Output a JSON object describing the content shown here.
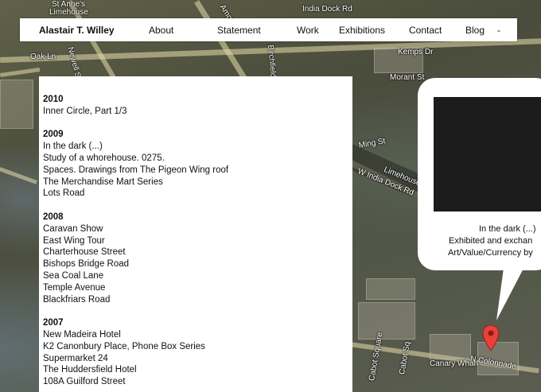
{
  "nav": {
    "brand": "Alastair T. Willey",
    "items": [
      "About",
      "Statement",
      "Work",
      "Exhibitions",
      "Contact",
      "Blog",
      "-"
    ]
  },
  "works": [
    {
      "year": "2010",
      "items": [
        "Inner Circle, Part 1/3"
      ]
    },
    {
      "year": "2009",
      "items": [
        "In the dark (...)",
        "Study of a whorehouse. 0275.",
        "Spaces. Drawings from The Pigeon Wing roof",
        "The Merchandise Mart Series",
        "Lots Road"
      ]
    },
    {
      "year": "2008",
      "items": [
        "Caravan Show",
        "East Wing Tour",
        "Charterhouse Street",
        "Bishops Bridge Road",
        "Sea Coal Lane",
        "Temple Avenue",
        "Blackfriars Road"
      ]
    },
    {
      "year": "2007",
      "items": [
        "New Madeira Hotel",
        "K2 Canonbury Place, Phone Box Series",
        "Supermarket 24",
        "The Huddersfield Hotel",
        "108A Guilford Street"
      ]
    }
  ],
  "bubble": {
    "caption_lines": [
      "In the dark (...)",
      "Exhibited and exchan",
      "Art/Value/Currency by"
    ]
  },
  "map_labels": [
    "St Anne's",
    "Limehouse",
    "Amoy Pl",
    "India Dock Rd",
    "Oak Ln",
    "Newell St",
    "Birchfield St",
    "Kemps Dr",
    "Morant St",
    "Ming St",
    "W India Dock Rd",
    "Limehouse",
    "Canary Wharf",
    "N Colonnade",
    "Cabot Square",
    "Cabot Sq"
  ],
  "colors": {
    "panel": "#ffffff",
    "text": "#111111",
    "marker": "#e8403a"
  },
  "icons": {
    "marker": "map-pin-icon"
  }
}
